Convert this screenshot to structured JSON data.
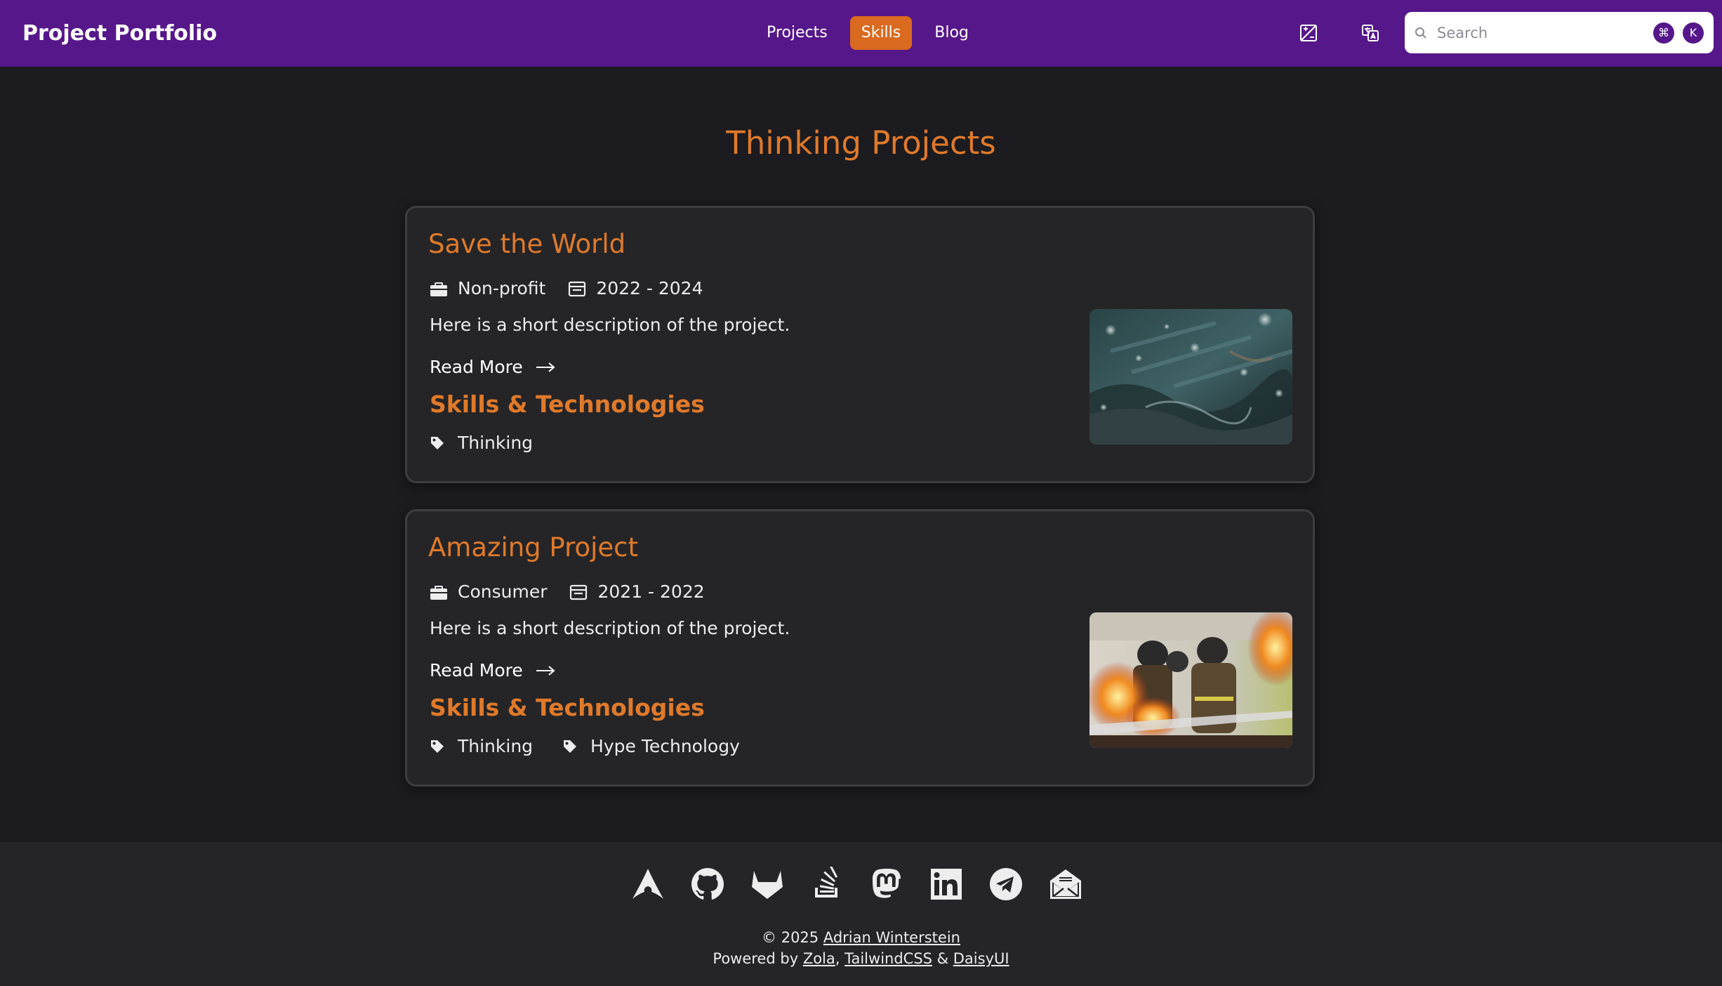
{
  "navbar": {
    "brand": "Project Portfolio",
    "links": [
      {
        "label": "Projects",
        "active": false
      },
      {
        "label": "Skills",
        "active": true
      },
      {
        "label": "Blog",
        "active": false
      }
    ],
    "icons": [
      "theme-toggle-icon",
      "translate-icon"
    ],
    "search": {
      "placeholder": "Search",
      "shortcut_keys": [
        "⌘",
        "K"
      ]
    },
    "colors": {
      "bar": "#56178a",
      "active": "#d96a1f"
    }
  },
  "main": {
    "title": "Thinking Projects",
    "projects": [
      {
        "title": "Save the World",
        "category": "Non-profit",
        "period": "2022 - 2024",
        "description": "Here is a short description of the project.",
        "read_more": "Read More",
        "skills_heading": "Skills & Technologies",
        "tags": [
          "Thinking"
        ],
        "image": "water-droplets-photo"
      },
      {
        "title": "Amazing Project",
        "category": "Consumer",
        "period": "2021 - 2022",
        "description": "Here is a short description of the project.",
        "read_more": "Read More",
        "skills_heading": "Skills & Technologies",
        "tags": [
          "Thinking",
          "Hype Technology"
        ],
        "image": "firefighters-photo"
      }
    ],
    "accent_color": "#e07a2a"
  },
  "footer": {
    "social_icons": [
      "arch-icon",
      "github-icon",
      "gitlab-icon",
      "stackoverflow-icon",
      "mastodon-icon",
      "linkedin-icon",
      "telegram-icon",
      "email-icon"
    ],
    "copyright_prefix": "© 2025",
    "author": "Adrian Winterstein",
    "powered_prefix": "Powered by",
    "powered_by": [
      "Zola",
      "TailwindCSS",
      "DaisyUI"
    ],
    "sep_comma": ",",
    "sep_and": "&"
  }
}
